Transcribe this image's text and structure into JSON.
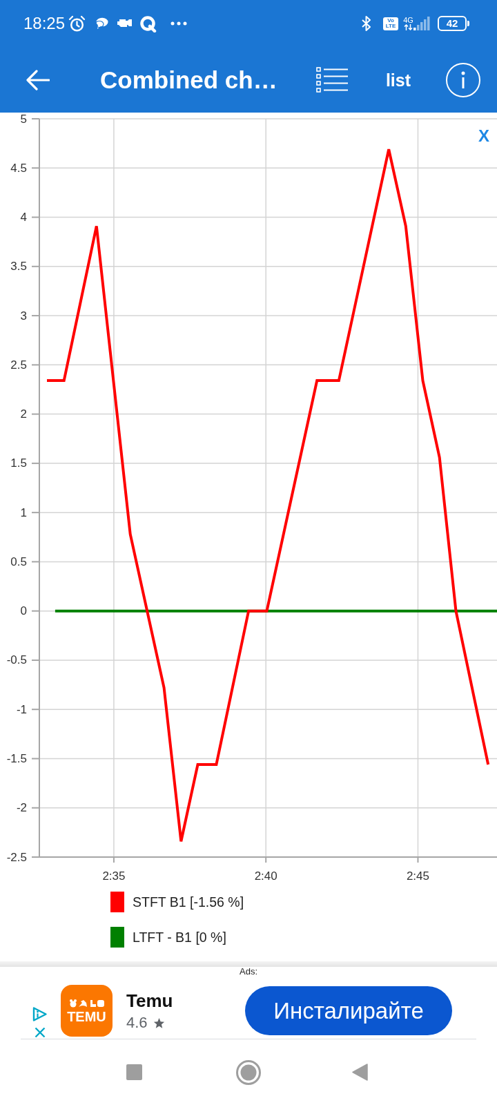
{
  "status_bar": {
    "time": "18:25",
    "network_badge": "Vo LTE",
    "network_type": "4G",
    "battery": "42"
  },
  "app_bar": {
    "title": "Combined ch…",
    "list_button": "list"
  },
  "chart": {
    "close_label": "X",
    "chart_data": {
      "type": "line",
      "grid": true,
      "x": [
        152.8,
        153.07,
        153.36,
        154.43,
        155.54,
        156.65,
        157.21,
        157.76,
        158.37,
        159.43,
        160.03,
        161.68,
        162.4,
        164.04,
        164.6,
        165.16,
        165.71,
        166.25,
        167.31,
        167.6
      ],
      "series": [
        {
          "name": "STFT B1 [-1.56 %]",
          "color": "#ff0000",
          "values": [
            2.34,
            2.34,
            2.34,
            3.91,
            0.78,
            -0.78,
            -2.34,
            -1.56,
            -1.56,
            0,
            0,
            2.34,
            2.34,
            4.69,
            3.91,
            2.34,
            1.56,
            0,
            -1.56,
            null
          ]
        },
        {
          "name": "LTFT - B1 [0 %]",
          "color": "#008000",
          "values": [
            null,
            0,
            0,
            0,
            0,
            0,
            0,
            0,
            0,
            0,
            0,
            0,
            0,
            0,
            0,
            0,
            0,
            0,
            0,
            0
          ]
        }
      ],
      "xlim": [
        152.55,
        167.6
      ],
      "ylim": [
        -2.5,
        5
      ],
      "xticks": [
        {
          "value": 155,
          "label": "2:35"
        },
        {
          "value": 160,
          "label": "2:40"
        },
        {
          "value": 165,
          "label": "2:45"
        }
      ],
      "yticks": [
        -2.5,
        -2,
        -1.5,
        -1,
        -0.5,
        0,
        0.5,
        1,
        1.5,
        2,
        2.5,
        3,
        3.5,
        4,
        4.5,
        5
      ]
    }
  },
  "ad": {
    "label": "Ads:",
    "logo_text": "TEMU",
    "app_name": "Temu",
    "rating": "4.6",
    "install_button": "Инсталирайте"
  }
}
